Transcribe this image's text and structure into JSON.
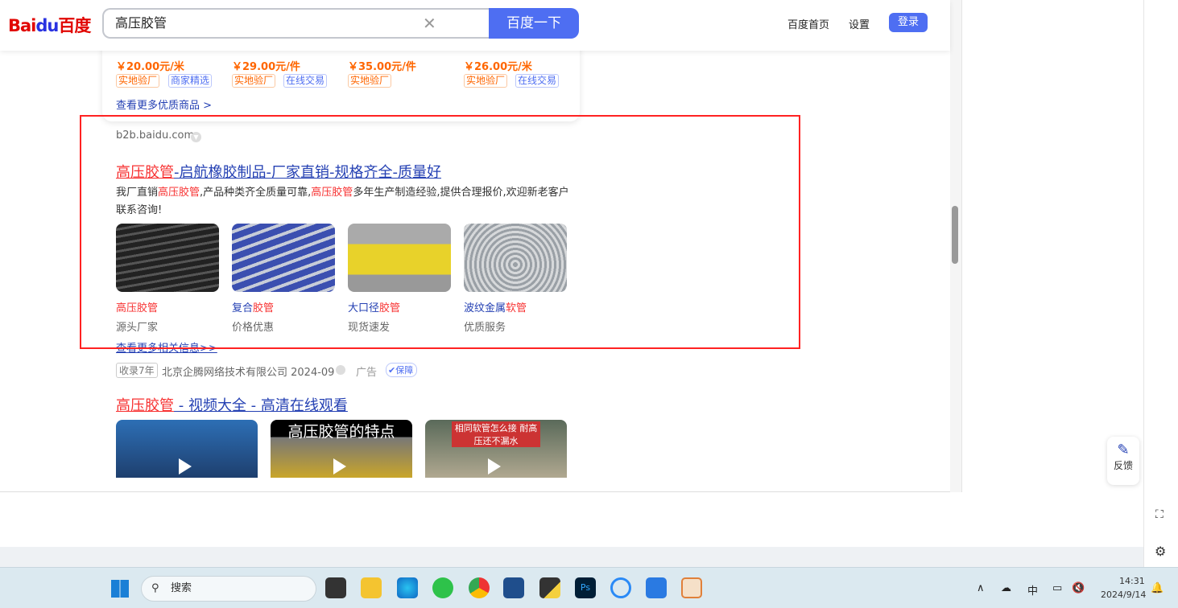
{
  "header": {
    "logo": "Bai",
    "logo_du": "du",
    "logo_cn": "百度",
    "search_value": "高压胶管",
    "search_button": "百度一下",
    "nav": [
      "百度首页",
      "设置"
    ],
    "login": "登录"
  },
  "products": [
    {
      "price": "￥20.00元/米",
      "tags": [
        "实地验厂",
        "商家精选"
      ]
    },
    {
      "price": "￥29.00元/件",
      "tags": [
        "实地验厂",
        "在线交易"
      ]
    },
    {
      "price": "￥35.00元/件",
      "tags": [
        "实地验厂"
      ]
    },
    {
      "price": "￥26.00元/米",
      "tags": [
        "实地验厂",
        "在线交易"
      ]
    }
  ],
  "more_products": "查看更多优质商品 >",
  "ad": {
    "domain": "b2b.baidu.com",
    "title_red": "高压胶管",
    "title_rest": "-启航橡胶制品-厂家直销-规格齐全-质量好",
    "desc": [
      "我厂直销",
      "高压胶管",
      ",产品种类齐全质量可靠,",
      "高压胶管",
      "多年生产制造经验,提供合理报价,欢迎新老客户联系咨询!"
    ],
    "items": [
      {
        "name_a": "高压",
        "name_b": "胶管",
        "name_c": "",
        "sub": "源头厂家",
        "color": "#3a3a3a"
      },
      {
        "name_a": "复合",
        "name_b": "胶管",
        "name_c": "",
        "sub": "价格优惠",
        "color": "#3b4fb0"
      },
      {
        "name_a": "大口径",
        "name_b": "胶管",
        "name_c": "",
        "sub": "现货速发",
        "color": "#e8d22a"
      },
      {
        "name_a": "波纹金属",
        "name_b": "软管",
        "name_c": "",
        "sub": "优质服务",
        "color": "#9aa0a6"
      }
    ],
    "more": "查看更多相关信息>>",
    "meta_tag": "收录7年",
    "company": "北京企腾网络技术有限公司 2024-09",
    "ad_label": "广告",
    "badge": "保障"
  },
  "video": {
    "title_red": "高压胶管",
    "title_rest": " - 视频大全 - 高清在线观看",
    "thumb_texts": [
      "",
      "高压胶管的特点",
      "相同软管怎么接 耐高压还不漏水"
    ]
  },
  "feedback": "反馈",
  "taskbar": {
    "search": "搜索",
    "lang": "中",
    "time": "14:31",
    "date": "2024/9/14"
  }
}
